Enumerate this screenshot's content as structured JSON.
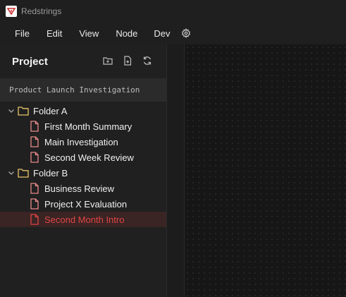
{
  "app": {
    "title": "Redstrings",
    "logo_icon": "redstrings-logo-icon"
  },
  "menu": {
    "items": [
      "File",
      "Edit",
      "View",
      "Node",
      "Dev"
    ],
    "settings_icon": "gear-icon"
  },
  "panel": {
    "title": "Project",
    "actions": [
      "new-folder-icon",
      "new-file-icon",
      "refresh-icon"
    ],
    "project_name": "Product Launch Investigation"
  },
  "tree": {
    "folders": [
      {
        "name": "Folder A",
        "expanded": true,
        "files": [
          "First Month Summary",
          "Main Investigation",
          "Second Week Review"
        ]
      },
      {
        "name": "Folder B",
        "expanded": true,
        "files": [
          "Business Review",
          "Project X Evaluation",
          "Second Month Intro"
        ]
      }
    ],
    "selected_file": "Second Month Intro"
  },
  "colors": {
    "accent": "#e04545",
    "file_icon": "#e88a8a",
    "folder_icon": "#e8c36a",
    "selected_bg": "#3a2424",
    "background": "#181818"
  }
}
